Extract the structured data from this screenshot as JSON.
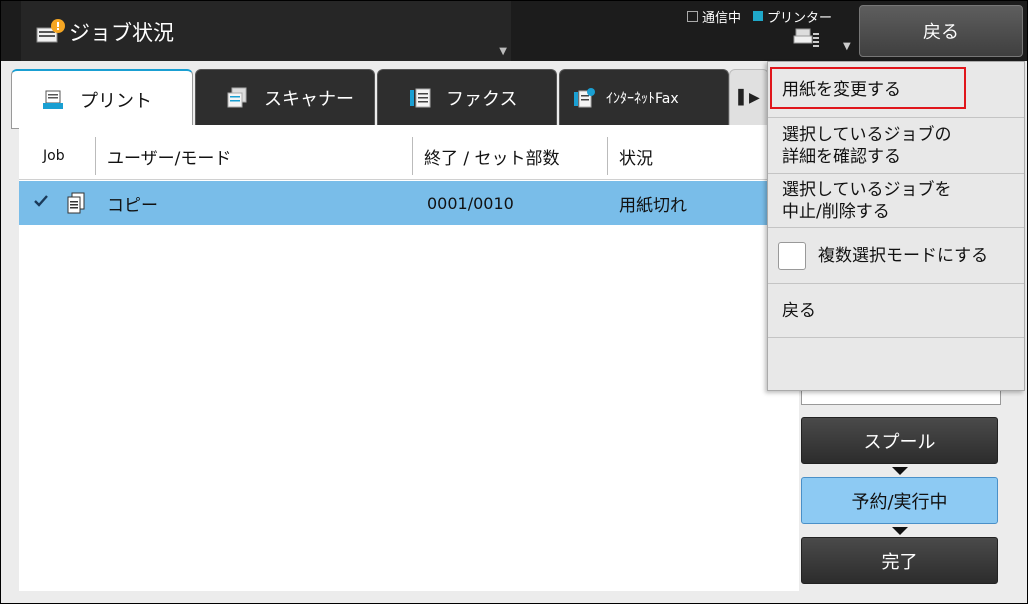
{
  "header": {
    "title": "ジョブ状況",
    "legend_comm": "通信中",
    "legend_printer": "プリンター",
    "back_label": "戻る"
  },
  "tabs": [
    {
      "label": "プリント",
      "icon": "print-job-icon",
      "active": true
    },
    {
      "label": "スキャナー",
      "icon": "scanner-icon",
      "active": false
    },
    {
      "label": "ファクス",
      "icon": "fax-icon",
      "active": false
    },
    {
      "label": "ｲﾝﾀｰﾈｯﾄFax",
      "icon": "internet-fax-icon",
      "active": false
    }
  ],
  "table": {
    "columns": [
      "Job",
      "ユーザー/モード",
      "終了 / セット部数",
      "状況"
    ],
    "rows": [
      {
        "selected": true,
        "mode": "コピー",
        "count": "0001/0010",
        "status": "用紙切れ"
      }
    ]
  },
  "menu": {
    "items": [
      "用紙を変更する",
      "選択しているジョブの\n詳細を確認する",
      "選択しているジョブを\n中止/削除する",
      "複数選択モードにする",
      "戻る"
    ]
  },
  "flow": {
    "spool": "スプール",
    "reserved": "予約/実行中",
    "complete": "完了"
  },
  "colors": {
    "accent": "#1a9fd2",
    "selected_row": "#79bde9",
    "highlight_border": "#e0151b",
    "printer_legend": "#1fa8c9"
  }
}
